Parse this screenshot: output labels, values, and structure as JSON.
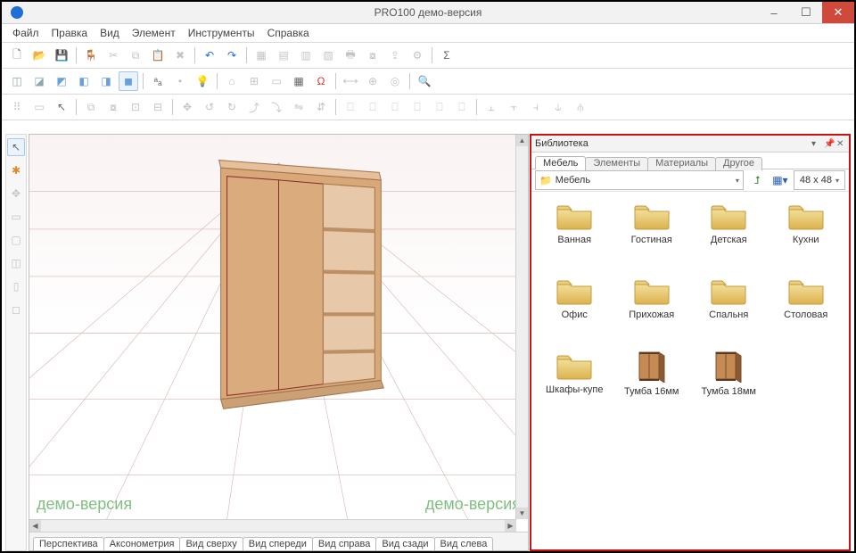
{
  "titlebar": {
    "title": "PRO100 демо-версия"
  },
  "menu": {
    "file": "Файл",
    "edit": "Правка",
    "view": "Вид",
    "element": "Элемент",
    "tools": "Инструменты",
    "help": "Справка"
  },
  "watermark": "демо-версия",
  "view_tabs": {
    "perspective": "Перспектива",
    "axon": "Аксонометрия",
    "top": "Вид сверху",
    "front": "Вид спереди",
    "right": "Вид справа",
    "back": "Вид сзади",
    "left": "Вид слева"
  },
  "library": {
    "title": "Библиотека",
    "tabs": {
      "furniture": "Мебель",
      "elements": "Элементы",
      "materials": "Материалы",
      "other": "Другое"
    },
    "path": "Мебель",
    "thumb_size": "48 x  48",
    "items": [
      {
        "label": "Ванная",
        "kind": "folder"
      },
      {
        "label": "Гостиная",
        "kind": "folder"
      },
      {
        "label": "Детская",
        "kind": "folder"
      },
      {
        "label": "Кухни",
        "kind": "folder"
      },
      {
        "label": "Офис",
        "kind": "folder"
      },
      {
        "label": "Прихожая",
        "kind": "folder"
      },
      {
        "label": "Спальня",
        "kind": "folder"
      },
      {
        "label": "Столовая",
        "kind": "folder"
      },
      {
        "label": "Шкафы-купе",
        "kind": "folder"
      },
      {
        "label": "Тумба 16мм",
        "kind": "thumb"
      },
      {
        "label": "Тумба 18мм",
        "kind": "thumb"
      }
    ]
  }
}
